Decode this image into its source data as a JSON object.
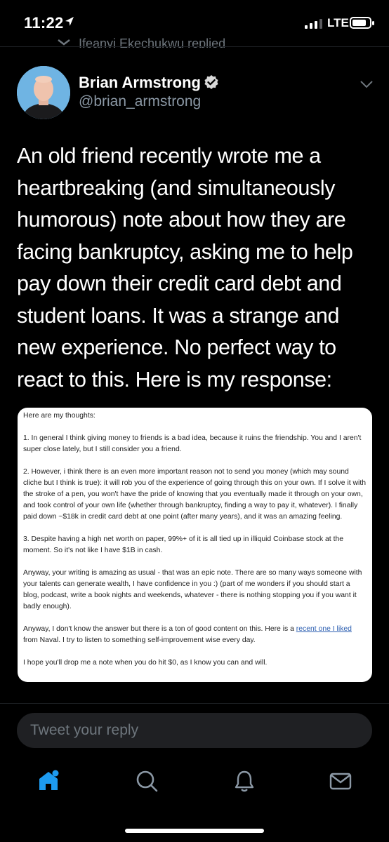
{
  "status_bar": {
    "time": "11:22",
    "network": "LTE"
  },
  "context_bar": {
    "replied_text": "Ifeanyi Ekechukwu replied"
  },
  "tweet": {
    "author_name": "Brian Armstrong",
    "author_handle": "@brian_armstrong",
    "text": "An old friend recently wrote me a heartbreaking (and simultaneously humorous) note about how they are facing bankruptcy, asking me to help pay down their credit card debt and student loans. It was a strange and new experience. No perfect way to react to this. Here is my response:"
  },
  "note": {
    "intro": "Here are my thoughts:",
    "point1": "1. In general I think giving money to friends is a bad idea, because it ruins the friendship. You and I aren't super close lately, but I still consider you a friend.",
    "point2": "2. However, i think there is an even more important reason not to send you money (which may sound cliche but I think is true): it will rob you of the experience of going through this on your own. If I solve it with the stroke of a pen, you won't have the pride of knowing that you eventually made it through on your own, and took control of your own life (whether through bankruptcy, finding a way to pay it, whatever). I finally paid down ~$18k in credit card debt at one point (after many years), and it was an amazing feeling.",
    "point3": "3. Despite having a high net worth on paper, 99%+ of it is all tied up in illiquid Coinbase stock at the moment. So it's not like I have $1B in cash.",
    "para_writing": "Anyway, your writing is amazing as usual - that was an epic note. There are so many ways someone with your talents can generate wealth, I have confidence in you :) (part of me wonders if you should start a blog, podcast, write a book nights and weekends, whatever - there is nothing stopping you if you want it badly enough).",
    "para_answer_before": "Anyway, I don't know the answer but there is a ton of good content on this. Here is a ",
    "para_answer_link": "recent one I liked",
    "para_answer_after": " from Naval. I try to listen to something self-improvement wise every day.",
    "closing": "I hope you'll drop me a note when you do hit $0, as I know you can and will."
  },
  "reply": {
    "placeholder": "Tweet your reply"
  },
  "tab_bar": {
    "items": [
      {
        "icon": "home-icon",
        "active": true
      },
      {
        "icon": "search-icon",
        "active": false
      },
      {
        "icon": "bell-icon",
        "active": false
      },
      {
        "icon": "mail-icon",
        "active": false
      }
    ]
  },
  "colors": {
    "accent": "#1d9bf0",
    "background": "#000000",
    "muted": "#6e767d"
  }
}
